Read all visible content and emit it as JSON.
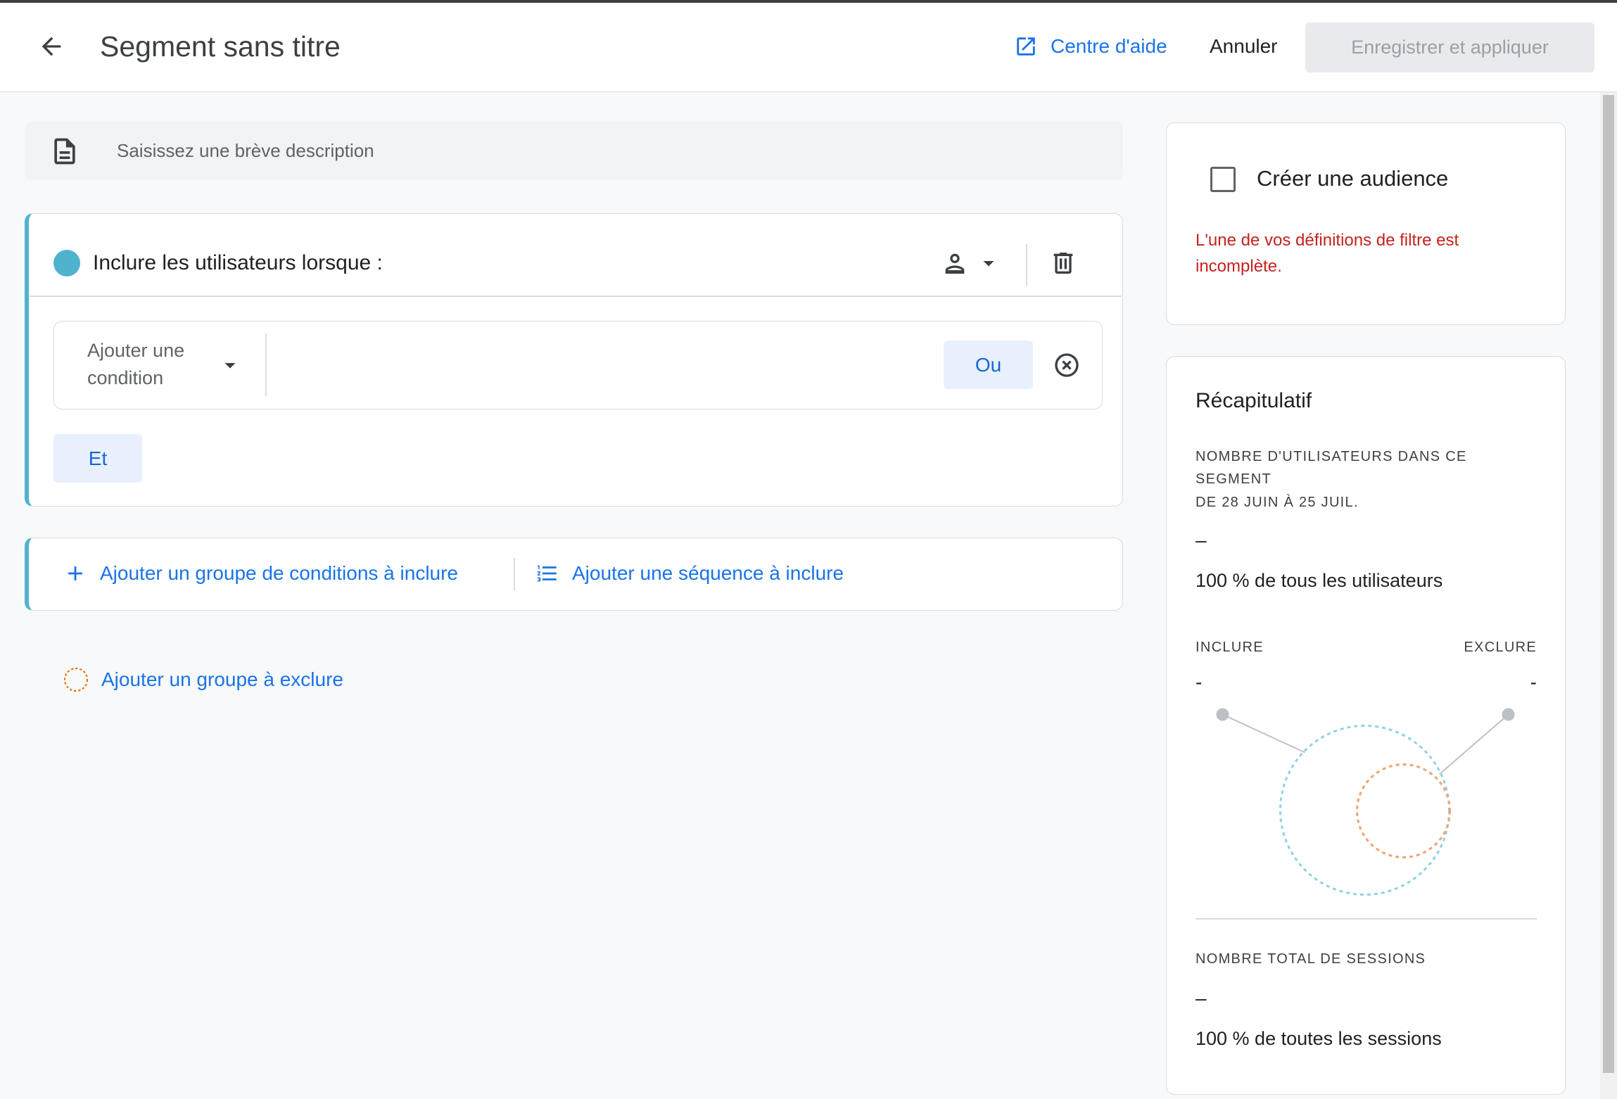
{
  "header": {
    "back_icon": "arrow-back-icon",
    "title": "Segment sans titre",
    "help_icon": "open-in-new-icon",
    "help_label": "Centre d'aide",
    "cancel_label": "Annuler",
    "save_label": "Enregistrer et appliquer"
  },
  "description": {
    "icon": "description-icon",
    "placeholder": "Saisissez une brève description"
  },
  "include_group": {
    "title": "Inclure les utilisateurs lorsque :",
    "scope_icon": "person-icon",
    "delete_icon": "delete-icon",
    "condition_placeholder": "Ajouter une condition",
    "or_label": "Ou",
    "remove_icon": "cancel-circle-icon",
    "and_label": "Et"
  },
  "add_actions": {
    "add_condition_group": "Ajouter un groupe de conditions à inclure",
    "add_sequence": "Ajouter une séquence à inclure",
    "add_exclude_group": "Ajouter un groupe à exclure"
  },
  "audience": {
    "label": "Créer une audience",
    "checked": false,
    "error": "L'une de vos définitions de filtre est incomplète."
  },
  "summary": {
    "title": "Récapitulatif",
    "users_label": "NOMBRE D'UTILISATEURS DANS CE SEGMENT",
    "date_range": "DE 28 JUIN À 25 JUIL.",
    "users_value": "–",
    "users_percent": "100 % de tous les utilisateurs",
    "include_label": "INCLURE",
    "include_value": "-",
    "exclude_label": "EXCLURE",
    "exclude_value": "-",
    "sessions_label": "NOMBRE TOTAL DE SESSIONS",
    "sessions_value": "–",
    "sessions_percent": "100 % de toutes les sessions"
  },
  "colors": {
    "link": "#1a73e8",
    "include": "#4fb3ce",
    "exclude": "#e8710a",
    "error": "#c5221f",
    "chip_bg": "#e8f0fe"
  }
}
